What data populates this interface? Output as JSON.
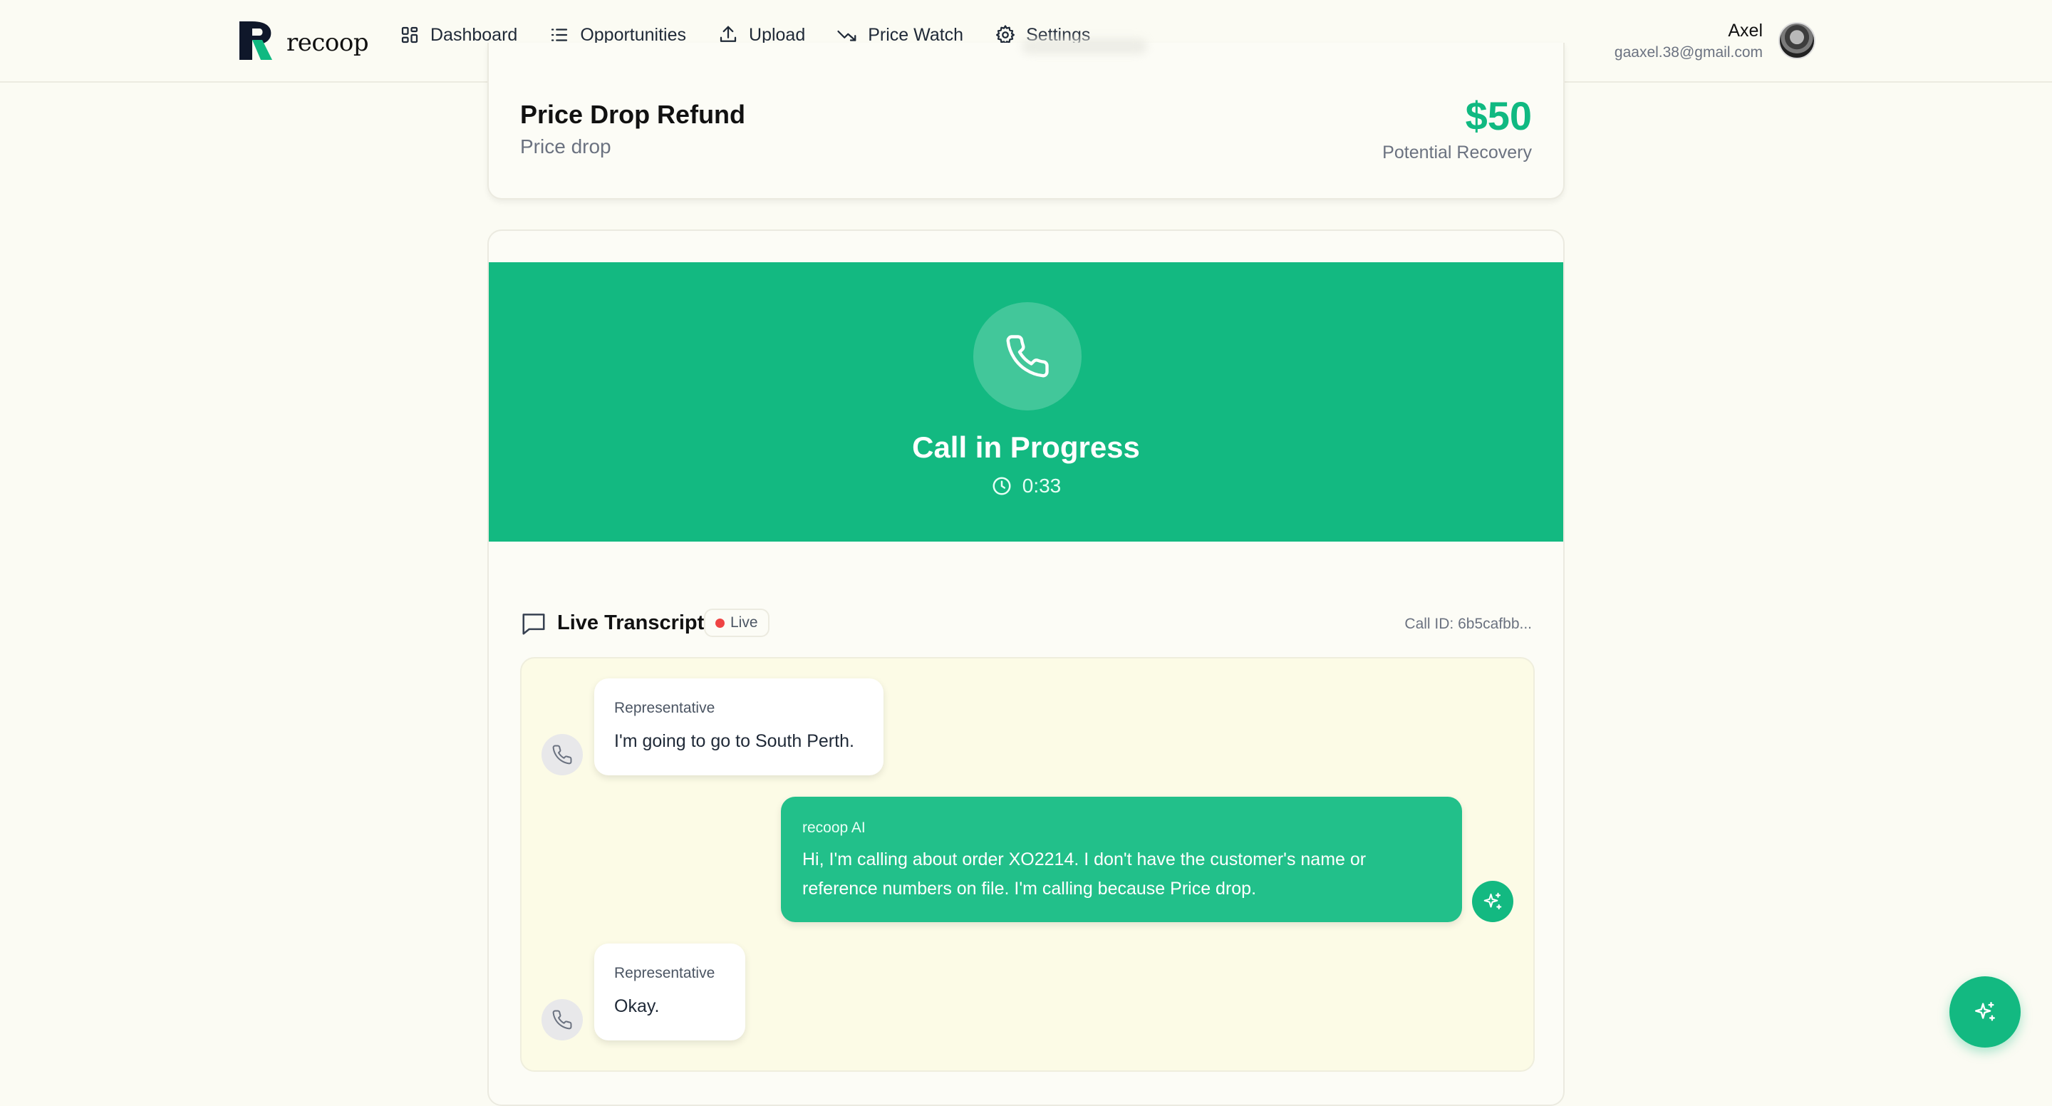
{
  "brand": {
    "name": "recoop"
  },
  "nav": {
    "items": [
      {
        "label": "Dashboard",
        "icon": "dashboard-grid-icon"
      },
      {
        "label": "Opportunities",
        "icon": "list-icon"
      },
      {
        "label": "Upload",
        "icon": "upload-icon"
      },
      {
        "label": "Price Watch",
        "icon": "trending-down-icon"
      },
      {
        "label": "Settings",
        "icon": "gear-icon"
      }
    ]
  },
  "user": {
    "name": "Axel",
    "email": "gaaxel.38@gmail.com"
  },
  "opportunity": {
    "title": "Price Drop Refund",
    "type": "Price drop",
    "amount": "$50",
    "amount_label": "Potential Recovery"
  },
  "call": {
    "status": "Call in Progress",
    "timer": "0:33"
  },
  "transcript": {
    "title": "Live Transcript",
    "badge": "Live",
    "call_id": "Call ID: 6b5cafbb...",
    "messages": [
      {
        "speaker": "Representative",
        "text": "I'm going to go to South Perth."
      },
      {
        "speaker": "recoop AI",
        "text": "Hi, I'm calling about order XO2214. I don't have the customer's name or reference numbers on file. I'm calling because Price drop."
      },
      {
        "speaker": "Representative",
        "text": "Okay."
      }
    ]
  },
  "colors": {
    "accent": "#13b981",
    "ai_bubble": "#22c08a",
    "background": "#fbfbf3",
    "live_dot": "#ef4444"
  }
}
